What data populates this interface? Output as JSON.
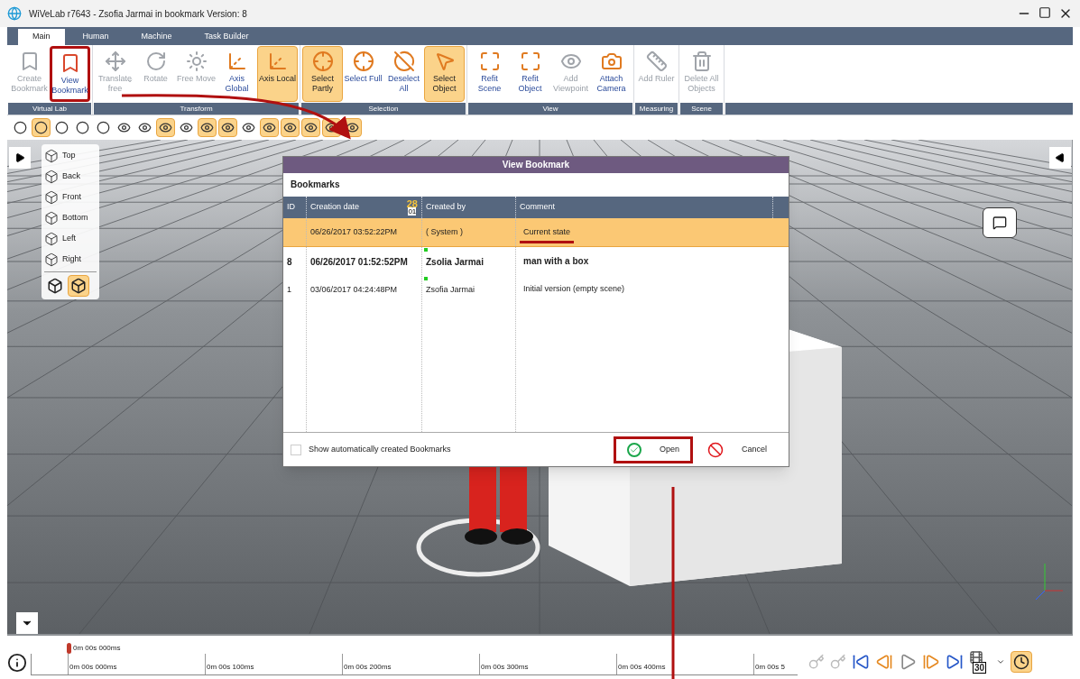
{
  "window": {
    "title": "WiVeLab r7643 - Zsofia Jarmai in bookmark Version: 8"
  },
  "tabs": [
    {
      "label": "Main",
      "selected": true
    },
    {
      "label": "Human",
      "selected": false
    },
    {
      "label": "Machine",
      "selected": false
    },
    {
      "label": "Task Builder",
      "selected": false
    }
  ],
  "ribbon_groups": [
    {
      "label": "Virtual Lab",
      "buttons": [
        {
          "label": "Create Bookmark",
          "kind": "bookmark-add",
          "disabled": true,
          "selected": false
        },
        {
          "label": "View Bookmark",
          "kind": "bookmark-view",
          "disabled": false,
          "selected": false,
          "highlighted": true
        }
      ]
    },
    {
      "label": "Transform",
      "buttons": [
        {
          "label": "Translate free",
          "kind": "translate",
          "disabled": true,
          "selected": false,
          "dropdown": true
        },
        {
          "label": "Rotate",
          "kind": "rotate",
          "disabled": true,
          "selected": false
        },
        {
          "label": "Free Move",
          "kind": "move",
          "disabled": true,
          "selected": false
        },
        {
          "label": "Axis Global",
          "kind": "axis",
          "disabled": false,
          "selected": false
        },
        {
          "label": "Axis Local",
          "kind": "axis",
          "disabled": false,
          "selected": true
        }
      ]
    },
    {
      "label": "Selection",
      "buttons": [
        {
          "label": "Select Partly",
          "kind": "select",
          "disabled": false,
          "selected": true
        },
        {
          "label": "Select Full",
          "kind": "select",
          "disabled": false,
          "selected": false
        },
        {
          "label": "Deselect All",
          "kind": "deselect",
          "disabled": false,
          "selected": false
        },
        {
          "label": "Select Object",
          "kind": "pointer",
          "disabled": false,
          "selected": true
        }
      ]
    },
    {
      "label": "View",
      "buttons": [
        {
          "label": "Refit Scene",
          "kind": "refit",
          "disabled": false,
          "selected": false
        },
        {
          "label": "Refit Object",
          "kind": "refit",
          "disabled": false,
          "selected": false
        },
        {
          "label": "Add Viewpoint",
          "kind": "viewpoint",
          "disabled": true,
          "selected": false
        },
        {
          "label": "Attach Camera",
          "kind": "camera",
          "disabled": false,
          "selected": false
        }
      ]
    },
    {
      "label": "Measuring",
      "buttons": [
        {
          "label": "Add Ruler",
          "kind": "ruler",
          "disabled": true,
          "selected": false
        }
      ]
    },
    {
      "label": "Scene",
      "buttons": [
        {
          "label": "Delete All Objects",
          "kind": "delete",
          "disabled": true,
          "selected": false
        }
      ]
    }
  ],
  "toolbar_buttons": [
    {
      "selected": false
    },
    {
      "selected": true
    },
    {
      "selected": false
    },
    {
      "selected": false
    },
    {
      "selected": false
    },
    {
      "selected": false
    },
    {
      "selected": false
    },
    {
      "selected": true
    },
    {
      "selected": false
    },
    {
      "selected": true
    },
    {
      "selected": true
    },
    {
      "selected": false
    },
    {
      "selected": true
    },
    {
      "selected": true
    },
    {
      "selected": true
    },
    {
      "selected": true
    },
    {
      "selected": true
    }
  ],
  "view_panel": {
    "items": [
      {
        "label": "Top"
      },
      {
        "label": "Back"
      },
      {
        "label": "Front"
      },
      {
        "label": "Bottom"
      },
      {
        "label": "Left"
      },
      {
        "label": "Right"
      }
    ],
    "modes": [
      {
        "selected": false
      },
      {
        "selected": true
      }
    ]
  },
  "dialog": {
    "title": "View Bookmark",
    "section": "Bookmarks",
    "columns": [
      "ID",
      "Creation date",
      "Created by",
      "Comment"
    ],
    "sort_badge": {
      "day": "28",
      "month": "01"
    },
    "rows": [
      {
        "id": "",
        "date": "06/26/2017 03:52:22PM",
        "created_by": "( System )",
        "comment": "Current state",
        "selected": true,
        "current": false,
        "marker": false,
        "underlined": true
      },
      {
        "id": "8",
        "date": "06/26/2017 01:52:52PM",
        "created_by": "Zsolia Jarmai",
        "comment": "man with a box",
        "selected": false,
        "current": true,
        "marker": true
      },
      {
        "id": "1",
        "date": "03/06/2017 04:24:48PM",
        "created_by": "Zsofia Jarmai",
        "comment": "Initial version (empty scene)",
        "selected": false,
        "current": false,
        "marker": true
      }
    ],
    "auto_checkbox": {
      "label": "Show automatically created Bookmarks",
      "checked": false
    },
    "buttons": [
      {
        "label": "Open",
        "highlighted": true
      },
      {
        "label": "Cancel",
        "highlighted": false
      }
    ]
  },
  "timeline": {
    "cursor": "0m 00s 000ms",
    "ticks": [
      "0m 00s 000ms",
      "0m 00s 100ms",
      "0m 00s 200ms",
      "0m 00s 300ms",
      "0m 00s 400ms",
      "0m 00s 5"
    ],
    "fps": "30",
    "clock_selected": true
  }
}
